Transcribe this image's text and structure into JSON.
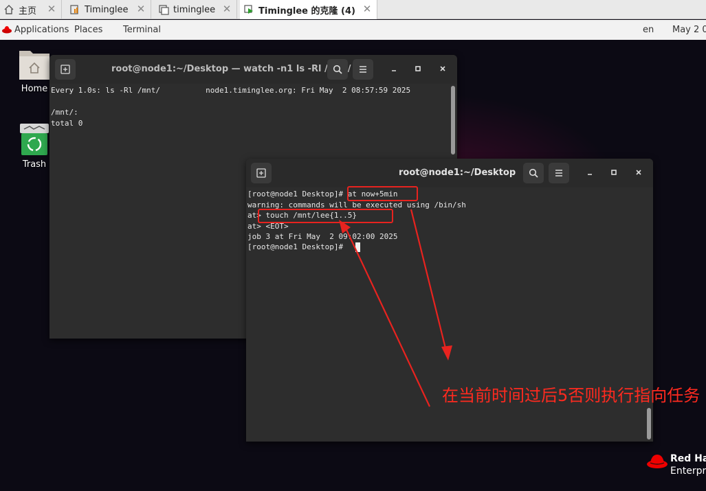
{
  "vm_tabs": [
    {
      "label": "主页",
      "icon": "home-icon"
    },
    {
      "label": "Timinglee",
      "icon": "vm-icon"
    },
    {
      "label": "timinglee",
      "icon": "vm-icon"
    },
    {
      "label": "Timinglee 的克隆 (4)",
      "icon": "vm-running-icon",
      "active": true
    }
  ],
  "topbar": {
    "applications": "Applications",
    "places": "Places",
    "terminal": "Terminal",
    "language": "en",
    "clock": "May 2 0"
  },
  "desktop_icons": [
    {
      "label": "Home",
      "icon": "home-folder-icon"
    },
    {
      "label": "Trash",
      "icon": "trash-icon"
    }
  ],
  "watch_terminal": {
    "title": "root@node1:~/Desktop — watch -n1 ls -Rl /mnt/",
    "lines": [
      "Every 1.0s: ls -Rl /mnt/          node1.timinglee.org: Fri May  2 08:57:59 2025",
      "",
      "/mnt/:",
      "total 0"
    ]
  },
  "main_terminal": {
    "title": "root@node1:~/Desktop",
    "lines": [
      "[root@node1 Desktop]# at now+5min",
      "warning: commands will be executed using /bin/sh",
      "at> touch /mnt/lee{1..5}",
      "at> <EOT>",
      "job 3 at Fri May  2 09:02:00 2025",
      "[root@node1 Desktop]# "
    ]
  },
  "annotation": {
    "text": "在当前时间过后5否则执行指向任务",
    "color": "#e8231f"
  },
  "brand": {
    "line1": "Red Ha",
    "line2": "Enterpr"
  }
}
